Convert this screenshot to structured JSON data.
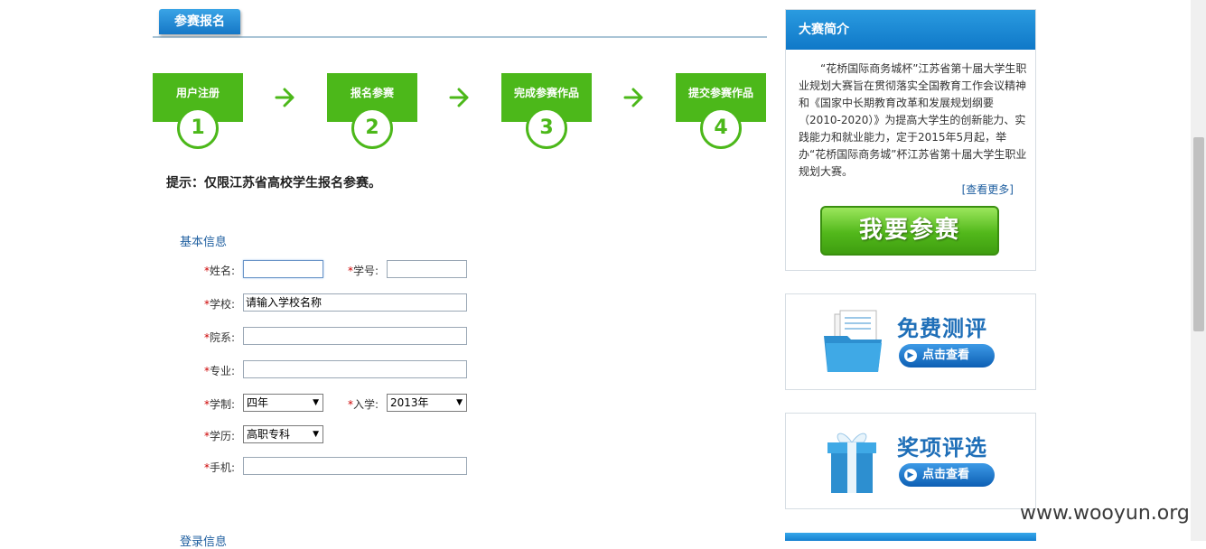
{
  "section": {
    "title": "参赛报名"
  },
  "steps": [
    {
      "label": "用户注册",
      "number": "1"
    },
    {
      "label": "报名参赛",
      "number": "2"
    },
    {
      "label": "完成参赛作品",
      "number": "3"
    },
    {
      "label": "提交参赛作品",
      "number": "4"
    }
  ],
  "hint": "提示：仅限江苏省高校学生报名参赛。",
  "form": {
    "basic_title": "基本信息",
    "login_title": "登录信息",
    "required_mark": "*",
    "name_label": "姓名:",
    "name_value": "",
    "student_id_label": "学号:",
    "student_id_value": "",
    "school_label": "学校:",
    "school_value": "请输入学校名称",
    "department_label": "院系:",
    "department_value": "",
    "major_label": "专业:",
    "major_value": "",
    "duration_label": "学制:",
    "duration_value": "四年",
    "enroll_label": "入学:",
    "enroll_value": "2013年",
    "degree_label": "学历:",
    "degree_value": "高职专科",
    "phone_label": "手机:",
    "phone_value": ""
  },
  "sidebar": {
    "intro_title": "大赛简介",
    "intro_text": "“花桥国际商务城杯”江苏省第十届大学生职业规划大赛旨在贯彻落实全国教育工作会议精神和《国家中长期教育改革和发展规划纲要（2010-2020）》为提高大学生的创新能力、实践能力和就业能力，定于2015年5月起，举办“花桥国际商务城”杯江苏省第十届大学生职业规划大赛。",
    "more_link": "[查看更多]",
    "join_button": "我要参赛",
    "promo1_title": "免费测评",
    "promo1_button": "点击查看",
    "promo2_title": "奖项评选",
    "promo2_button": "点击查看"
  },
  "watermark": "www.wooyun.org",
  "colors": {
    "step_green": "#4cb81a",
    "header_blue": "#1577c6",
    "link_blue": "#1f5fa0",
    "required_red": "#cc0000"
  },
  "icons": {
    "step_arrow": "arrow-right-icon",
    "promo1": "folder-documents-icon",
    "promo2": "gift-box-icon",
    "promo_button": "play-circle-icon"
  }
}
